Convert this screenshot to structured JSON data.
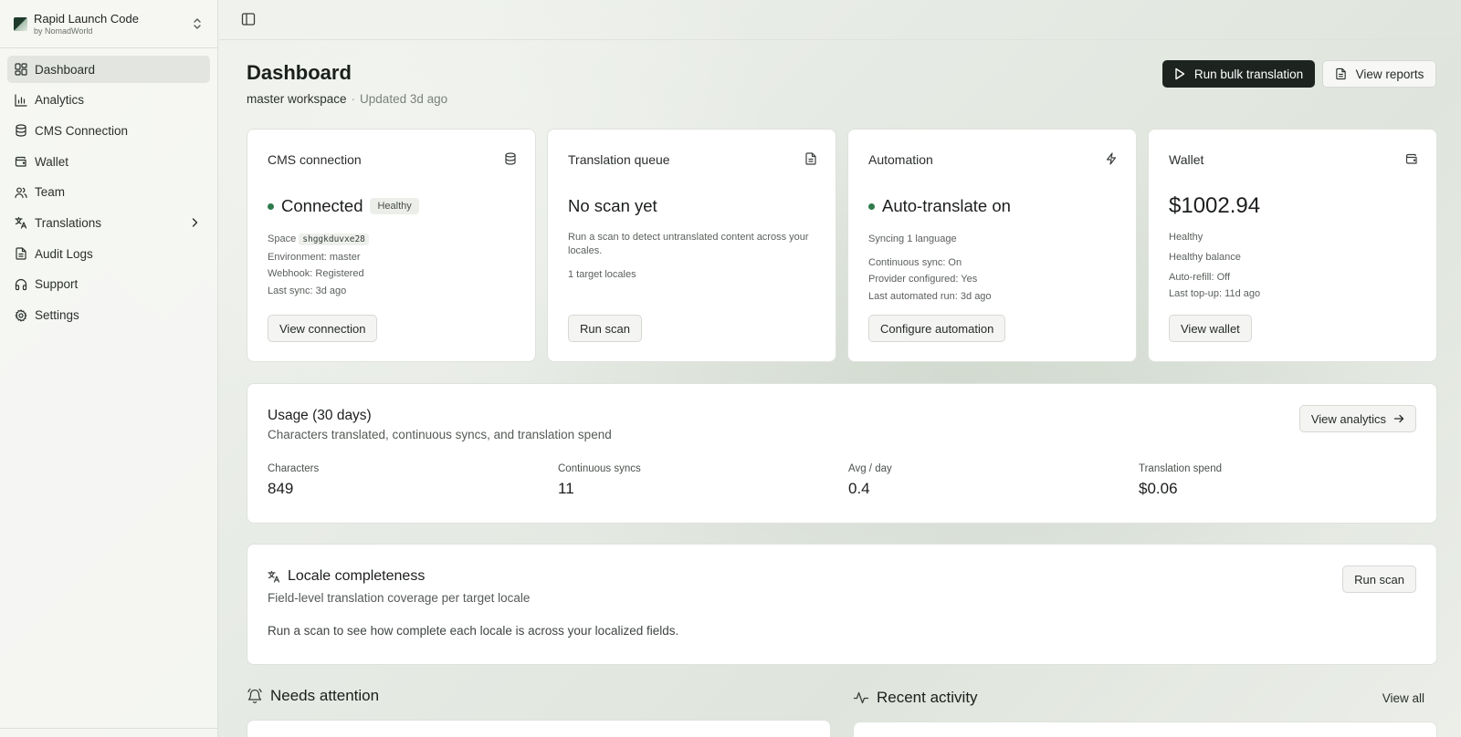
{
  "brand": {
    "name": "Rapid Launch Code",
    "sub": "by NomadWorld"
  },
  "sidebar": {
    "items": [
      {
        "label": "Dashboard",
        "icon": "dashboard-icon",
        "active": true
      },
      {
        "label": "Analytics",
        "icon": "bar-chart-icon"
      },
      {
        "label": "CMS Connection",
        "icon": "database-icon"
      },
      {
        "label": "Wallet",
        "icon": "wallet-icon"
      },
      {
        "label": "Team",
        "icon": "users-icon"
      },
      {
        "label": "Translations",
        "icon": "languages-icon",
        "expandable": true
      },
      {
        "label": "Audit Logs",
        "icon": "file-text-icon"
      },
      {
        "label": "Support",
        "icon": "headphones-icon"
      },
      {
        "label": "Settings",
        "icon": "gear-icon"
      }
    ]
  },
  "header": {
    "title": "Dashboard",
    "workspace": "master workspace",
    "separator": "·",
    "updated": "Updated 3d ago",
    "primary_action": "Run bulk translation",
    "secondary_action": "View reports"
  },
  "cards": {
    "cms": {
      "title": "CMS connection",
      "status": "Connected",
      "badge": "Healthy",
      "space_label": "Space",
      "space_id": "shggkduvxe28",
      "environment": "Environment: master",
      "webhook": "Webhook: Registered",
      "last_sync": "Last sync: 3d ago",
      "button": "View connection"
    },
    "queue": {
      "title": "Translation queue",
      "status": "No scan yet",
      "desc": "Run a scan to detect untranslated content across your locales.",
      "locales": "1 target locales",
      "button": "Run scan"
    },
    "automation": {
      "title": "Automation",
      "status": "Auto-translate on",
      "syncing": "Syncing 1 language",
      "continuous": "Continuous sync: On",
      "provider": "Provider configured: Yes",
      "last_run": "Last automated run: 3d ago",
      "button": "Configure automation"
    },
    "wallet": {
      "title": "Wallet",
      "balance": "$1002.94",
      "status": "Healthy",
      "status_detail": "Healthy balance",
      "auto_refill": "Auto-refill: Off",
      "last_topup": "Last top-up: 11d ago",
      "button": "View wallet"
    }
  },
  "usage": {
    "title": "Usage (30 days)",
    "subtitle": "Characters translated, continuous syncs, and translation spend",
    "button": "View analytics",
    "metrics": [
      {
        "label": "Characters",
        "value": "849"
      },
      {
        "label": "Continuous syncs",
        "value": "11"
      },
      {
        "label": "Avg / day",
        "value": "0.4"
      },
      {
        "label": "Translation spend",
        "value": "$0.06"
      }
    ]
  },
  "locale": {
    "title": "Locale completeness",
    "subtitle": "Field-level translation coverage per target locale",
    "note": "Run a scan to see how complete each locale is across your localized fields.",
    "button": "Run scan"
  },
  "attention": {
    "title": "Needs attention"
  },
  "activity": {
    "title": "Recent activity",
    "view_all": "View all"
  },
  "colors": {
    "accent": "#1d2420",
    "status_green": "#2f7a4d"
  }
}
